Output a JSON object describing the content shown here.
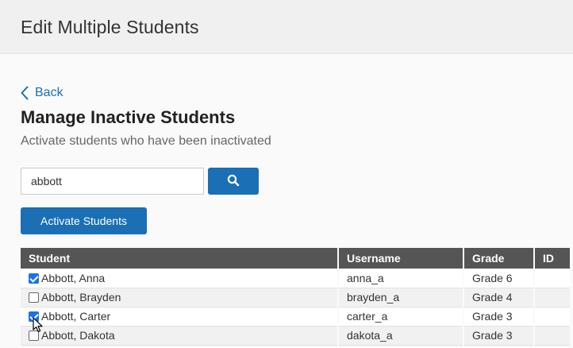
{
  "header": {
    "title": "Edit Multiple Students"
  },
  "nav": {
    "back_label": "Back"
  },
  "main": {
    "title": "Manage Inactive Students",
    "subtitle": "Activate students who have been inactivated",
    "search": {
      "value": "abbott",
      "placeholder": ""
    },
    "activate_label": "Activate Students"
  },
  "table": {
    "columns": [
      "Student",
      "Username",
      "Grade",
      "ID"
    ],
    "rows": [
      {
        "checked": true,
        "student": "Abbott, Anna",
        "username": "anna_a",
        "grade": "Grade 6",
        "id": ""
      },
      {
        "checked": false,
        "student": "Abbott, Brayden",
        "username": "brayden_a",
        "grade": "Grade 4",
        "id": ""
      },
      {
        "checked": true,
        "student": "Abbott, Carter",
        "username": "carter_a",
        "grade": "Grade 3",
        "id": ""
      },
      {
        "checked": false,
        "student": "Abbott, Dakota",
        "username": "dakota_a",
        "grade": "Grade 3",
        "id": ""
      }
    ]
  },
  "icons": {
    "back": "chevron-left-icon",
    "search": "search-icon",
    "cursor": "mouse-pointer-icon"
  },
  "colors": {
    "accent": "#1a6fb5",
    "header_bg": "#555555",
    "checkbox": "#1a73e8"
  }
}
